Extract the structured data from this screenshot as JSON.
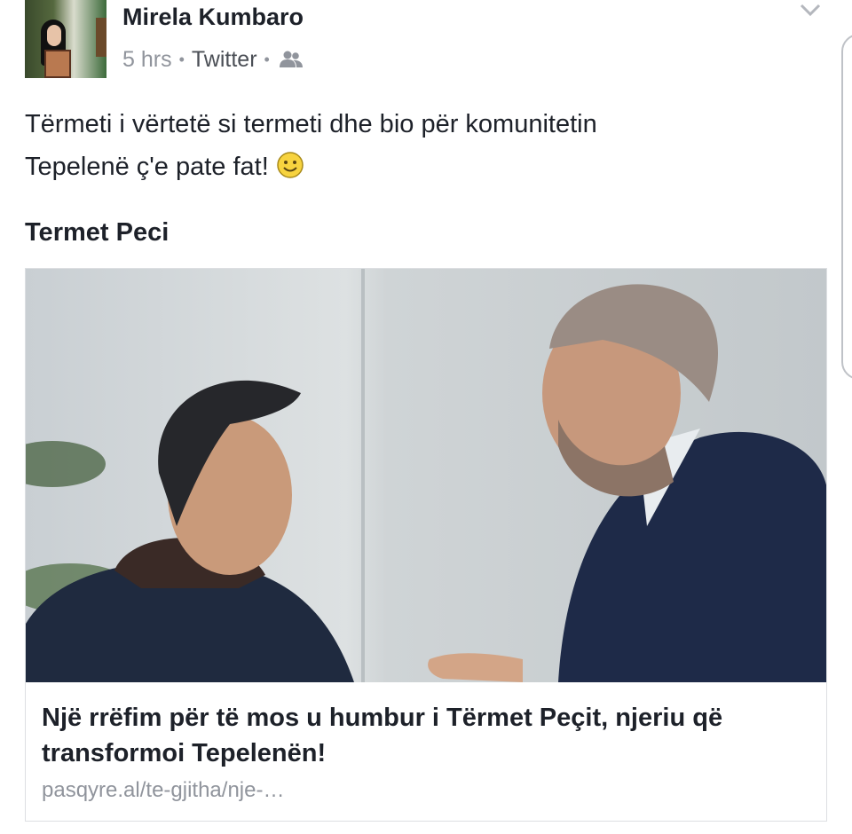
{
  "post": {
    "author": "Mirela Kumbaro",
    "time": "5 hrs",
    "separator": "•",
    "via": "Twitter",
    "audience_icon": "friends-icon",
    "text_line1": "Tërmeti i vërtetë si termeti dhe bio për komunitetin",
    "text_line2": "Tepelenë ç'e pate fat!",
    "emoji": "smiley-icon",
    "shared_name": "Termet Peci"
  },
  "link_card": {
    "title": "Një rrëfim për të mos u humbur i Tërmet Peçit, njeriu që transformoi Tepelenën!",
    "url": "pasqyre.al/te-gjitha/nje-…"
  },
  "icons": {
    "options": "chevron-down-icon"
  },
  "colors": {
    "text": "#1d2129",
    "meta": "#90949c",
    "border": "#dddfe2"
  }
}
